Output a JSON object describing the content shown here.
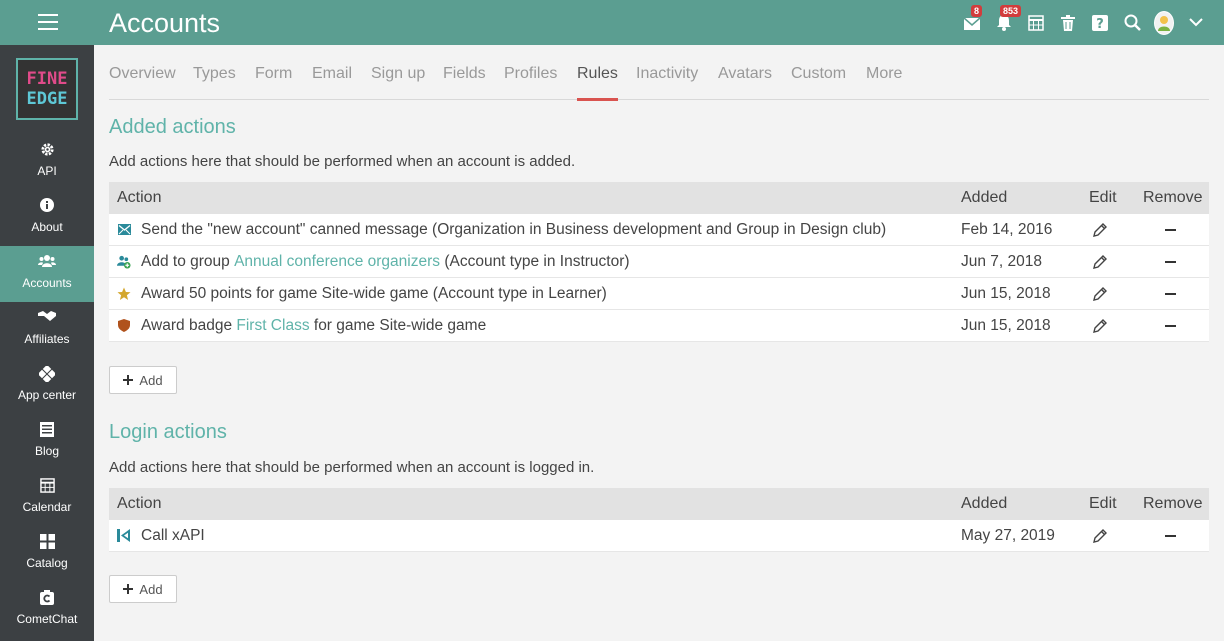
{
  "header": {
    "title": "Accounts",
    "messages_badge": "8",
    "notifications_badge": "853"
  },
  "colors": {
    "topbar": "#5b9e91",
    "sidebar": "#3c4043",
    "accent": "#5fb3a9",
    "active_tab": "#d9534f",
    "badge": "#d23c3c"
  },
  "sidebar": {
    "logo_line1": "FINE",
    "logo_line2": "EDGE",
    "items": [
      {
        "label": "API",
        "icon": "gear-icon"
      },
      {
        "label": "About",
        "icon": "info-icon"
      },
      {
        "label": "Accounts",
        "icon": "users-icon"
      },
      {
        "label": "Affiliates",
        "icon": "handshake-icon"
      },
      {
        "label": "App center",
        "icon": "apps-icon"
      },
      {
        "label": "Blog",
        "icon": "blog-icon"
      },
      {
        "label": "Calendar",
        "icon": "calendar-icon"
      },
      {
        "label": "Catalog",
        "icon": "catalog-icon"
      },
      {
        "label": "CometChat",
        "icon": "cometchat-icon"
      }
    ]
  },
  "tabs": [
    "Overview",
    "Types",
    "Form",
    "Email",
    "Sign up",
    "Fields",
    "Profiles",
    "Rules",
    "Inactivity",
    "Avatars",
    "Custom",
    "More"
  ],
  "active_tab": "Rules",
  "table_headers": {
    "action": "Action",
    "added": "Added",
    "edit": "Edit",
    "remove": "Remove"
  },
  "added_section": {
    "title": "Added actions",
    "description": "Add actions here that should be performed when an account is added.",
    "rows": [
      {
        "pre": "Send the \"new account\" canned message (Organization in Business development and Group in Design club)",
        "link": "",
        "post": "",
        "date": "Feb 14, 2016",
        "icon": "envelope-icon"
      },
      {
        "pre": "Add to group ",
        "link": "Annual conference organizers",
        "post": " (Account type in Instructor)",
        "date": "Jun 7, 2018",
        "icon": "group-add-icon"
      },
      {
        "pre": "Award 50 points for game Site-wide game (Account type in Learner)",
        "link": "",
        "post": "",
        "date": "Jun 15, 2018",
        "icon": "star-icon"
      },
      {
        "pre": "Award badge ",
        "link": "First Class",
        "post": " for game Site-wide game",
        "date": "Jun 15, 2018",
        "icon": "badge-icon"
      }
    ],
    "add_label": "Add"
  },
  "login_section": {
    "title": "Login actions",
    "description": "Add actions here that should be performed when an account is logged in.",
    "rows": [
      {
        "pre": "Call xAPI",
        "link": "",
        "post": "",
        "date": "May 27, 2019",
        "icon": "xapi-icon"
      }
    ],
    "add_label": "Add"
  }
}
